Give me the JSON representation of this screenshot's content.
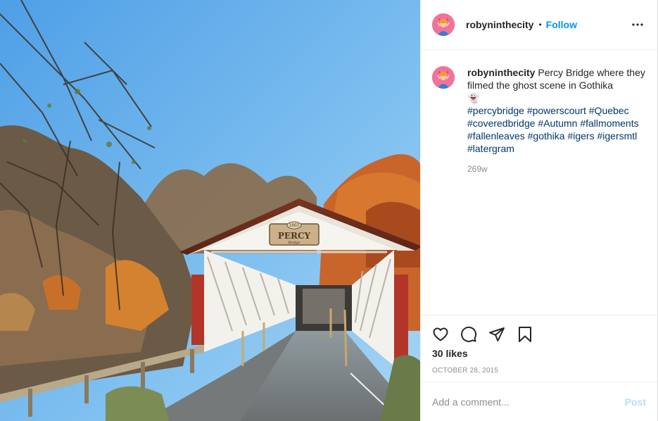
{
  "post": {
    "photo": {
      "sign_year": "1865",
      "sign_name": "PERCY",
      "sign_sub": "Bridge"
    },
    "header": {
      "username": "robyninthecity",
      "separator": "•",
      "follow_label": "Follow",
      "more_icon": "more-horizontal-icon"
    },
    "caption": {
      "username": "robyninthecity",
      "text": "Percy Bridge where they filmed the ghost scene in Gothika",
      "emoji": "👻",
      "hashtags": [
        "#percybridge",
        "#powerscourt",
        "#Quebec",
        "#coveredbridge",
        "#Autumn",
        "#fallmoments",
        "#fallenleaves",
        "#gothika",
        "#igers",
        "#igersmtl",
        "#latergram"
      ],
      "age": "269w"
    },
    "actions": {
      "like_icon": "heart-icon",
      "comment_icon": "comment-icon",
      "share_icon": "share-icon",
      "save_icon": "bookmark-icon"
    },
    "likes": "30 likes",
    "date": "OCTOBER 28, 2015",
    "comment_box": {
      "placeholder": "Add a comment...",
      "post_label": "Post"
    },
    "colors": {
      "link": "#0095f6",
      "hashtag": "#00376b",
      "muted": "#8e8e8e",
      "post_disabled": "#b2dffc",
      "avatar_bg": "#f0739b"
    }
  }
}
